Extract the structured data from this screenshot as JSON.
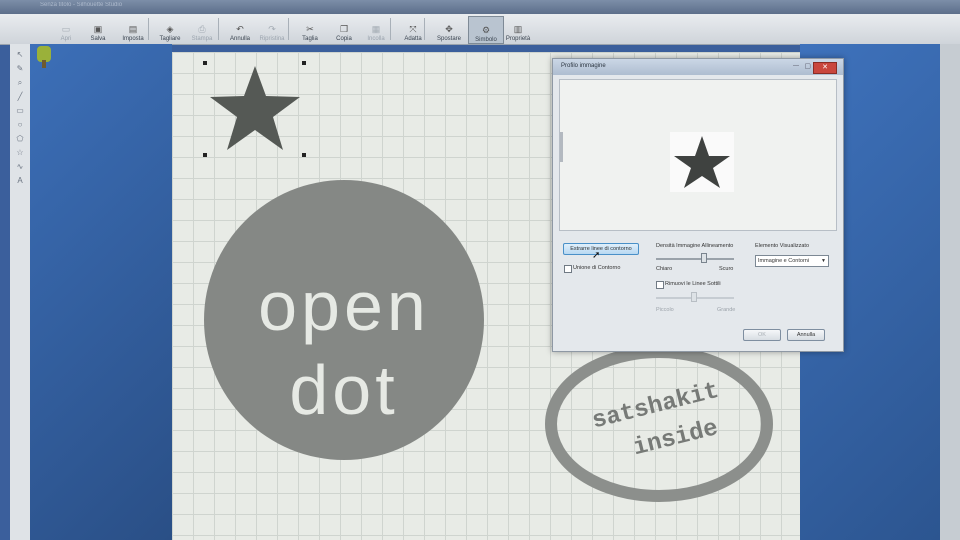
{
  "window": {
    "title": "Senza titolo - Silhouette Studio"
  },
  "toolbar": {
    "buttons": [
      {
        "label": "Apri",
        "icon": "folder-icon",
        "dim": true
      },
      {
        "label": "Salva",
        "icon": "save-icon",
        "dim": false
      },
      {
        "label": "Imposta",
        "icon": "page-setup-icon",
        "dim": false
      },
      {
        "label": "Tagliare",
        "icon": "cutter-icon",
        "dim": false
      },
      {
        "label": "Stampa",
        "icon": "print-icon",
        "dim": true
      },
      {
        "label": "Annulla",
        "icon": "undo-icon",
        "dim": false
      },
      {
        "label": "Ripristina",
        "icon": "redo-icon",
        "dim": true
      },
      {
        "label": "Taglia",
        "icon": "scissors-icon",
        "dim": false
      },
      {
        "label": "Copia",
        "icon": "copy-icon",
        "dim": false
      },
      {
        "label": "Incolla",
        "icon": "paste-icon",
        "dim": true
      },
      {
        "label": "Adatta",
        "icon": "fit-icon",
        "dim": false
      },
      {
        "label": "Spostare",
        "icon": "move-icon",
        "dim": false
      },
      {
        "label": "Simbolo",
        "icon": "symbol-icon",
        "dim": false,
        "active": true
      },
      {
        "label": "Proprietà",
        "icon": "properties-icon",
        "dim": false
      }
    ]
  },
  "canvas": {
    "logo_line1": "open",
    "logo_line2": "dot",
    "badge_line1": "satshakit",
    "badge_line2": "inside"
  },
  "dialog": {
    "title": "Profilo immagine",
    "close_label": "✕",
    "extract_button": "Estrarre linee di contorno",
    "union_label": "Unione di Contorno",
    "density_label": "Densità Immagine Allineamento",
    "density_min": "Chiaro",
    "density_max": "Scuro",
    "density_value": 0.6,
    "remove_thin_label": "Rimuovi le Linee Sottili",
    "thin_min": "Piccolo",
    "thin_max": "Grande",
    "element_label": "Elemento Visualizzato",
    "element_value": "Immagine e Contorni",
    "ok_label": "OK",
    "cancel_label": "Annulla"
  }
}
